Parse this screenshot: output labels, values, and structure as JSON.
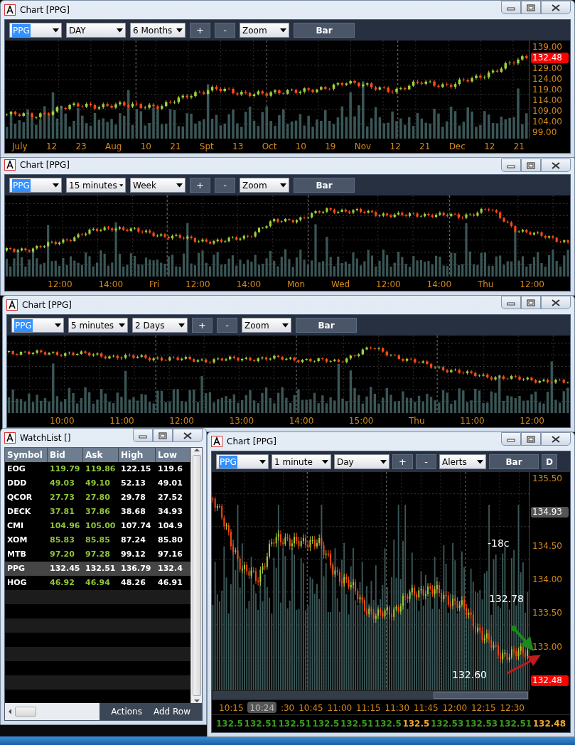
{
  "charts": [
    {
      "title": "Chart [PPG]",
      "symbol": "PPG",
      "interval": "DAY",
      "range": "6 Months",
      "plus": "+",
      "minus": "-",
      "tool": "Zoom",
      "style": "Bar",
      "y_labels": [
        {
          "text": "139.00",
          "kind": "tick"
        },
        {
          "text": "132.48",
          "kind": "tag",
          "color": "#ff0000"
        },
        {
          "text": "129.00",
          "kind": "tick"
        },
        {
          "text": "124.00",
          "kind": "tick"
        },
        {
          "text": "119.00",
          "kind": "tick"
        },
        {
          "text": "114.00",
          "kind": "tick"
        },
        {
          "text": "109.00",
          "kind": "tick"
        },
        {
          "text": "104.00",
          "kind": "tick"
        },
        {
          "text": "99.00",
          "kind": "tick"
        }
      ],
      "x_labels": [
        "July",
        "12",
        "23",
        "Aug",
        "10",
        "21",
        "Spt",
        "13",
        "Oct",
        "10",
        "19",
        "Nov",
        "12",
        "21",
        "Dec",
        "12",
        "21"
      ]
    },
    {
      "title": "Chart [PPG]",
      "symbol": "PPG",
      "interval": "15 minutes",
      "range": "Week",
      "plus": "+",
      "minus": "-",
      "tool": "Zoom",
      "style": "Bar",
      "x_labels": [
        "12:00",
        "14:00",
        "Fri",
        "12:00",
        "14:00",
        "Mon",
        "Wed",
        "12:00",
        "14:00",
        "Thu",
        "12:00"
      ]
    },
    {
      "title": "Chart [PPG]",
      "symbol": "PPG",
      "interval": "5 minutes",
      "range": "2 Days",
      "plus": "+",
      "minus": "-",
      "tool": "Zoom",
      "style": "Bar",
      "x_labels": [
        "10:00",
        "11:00",
        "12:00",
        "13:00",
        "14:00",
        "15:00",
        "Thu",
        "11:00",
        "12:00"
      ]
    },
    {
      "title": "Chart [PPG]",
      "symbol": "PPG",
      "interval": "1 minute",
      "range": "Day",
      "plus": "+",
      "minus": "-",
      "tool": "Alerts",
      "style": "Bar",
      "extra_button": "D",
      "y_labels": [
        {
          "text": "135.50",
          "kind": "tick"
        },
        {
          "text": "134.93",
          "kind": "tag",
          "color": "#555555"
        },
        {
          "text": "134.50",
          "kind": "tick"
        },
        {
          "text": "134.00",
          "kind": "tick"
        },
        {
          "text": "133.50",
          "kind": "tick"
        },
        {
          "text": "133.00",
          "kind": "tick"
        },
        {
          "text": "132.48",
          "kind": "tag",
          "color": "#ff0000"
        }
      ],
      "x_labels": [
        "10:15",
        ":30",
        "10:45",
        "11:00",
        "11:15",
        "11:30",
        "11:45",
        "12:00",
        "12:15",
        "12:30"
      ],
      "scroll_label": "10:24",
      "annotations": [
        "-18c",
        "132.78",
        "132.60"
      ],
      "ticker": [
        {
          "text": "132.5",
          "color": "#3c9a1e"
        },
        {
          "text": "132.51",
          "color": "#3c9a1e"
        },
        {
          "text": "132.51",
          "color": "#3c9a1e"
        },
        {
          "text": "132.5",
          "color": "#3c9a1e"
        },
        {
          "text": "132.51",
          "color": "#3c9a1e"
        },
        {
          "text": "132.5",
          "color": "#3c9a1e"
        },
        {
          "text": "132.5",
          "color": "#f0a830"
        },
        {
          "text": "132.53",
          "color": "#3c9a1e"
        },
        {
          "text": "132.53",
          "color": "#3c9a1e"
        },
        {
          "text": "132.51",
          "color": "#3c9a1e"
        },
        {
          "text": "132.48",
          "color": "#f0a830"
        }
      ]
    }
  ],
  "watchlist": {
    "title": "WatchList []",
    "columns": [
      "Symbol",
      "Bid",
      "Ask",
      "High",
      "Low"
    ],
    "rows": [
      {
        "cells": [
          "EOG",
          "119.79",
          "119.86",
          "122.15",
          "119.6"
        ],
        "selected": false
      },
      {
        "cells": [
          "DDD",
          "49.03",
          "49.10",
          "52.13",
          "49.01"
        ],
        "selected": false
      },
      {
        "cells": [
          "QCOR",
          "27.73",
          "27.80",
          "29.78",
          "27.52"
        ],
        "selected": false
      },
      {
        "cells": [
          "DECK",
          "37.81",
          "37.86",
          "38.68",
          "34.93"
        ],
        "selected": false
      },
      {
        "cells": [
          "CMI",
          "104.96",
          "105.00",
          "107.74",
          "104.9"
        ],
        "selected": false
      },
      {
        "cells": [
          "XOM",
          "85.83",
          "85.85",
          "87.24",
          "85.80"
        ],
        "selected": false
      },
      {
        "cells": [
          "MTB",
          "97.20",
          "97.28",
          "99.12",
          "97.16"
        ],
        "selected": false
      },
      {
        "cells": [
          "PPG",
          "132.45",
          "132.51",
          "136.79",
          "132.4"
        ],
        "selected": true
      },
      {
        "cells": [
          "HOG",
          "46.92",
          "46.94",
          "48.26",
          "46.91"
        ],
        "selected": false
      }
    ],
    "buttons": [
      "Actions",
      "Add Row"
    ]
  }
}
